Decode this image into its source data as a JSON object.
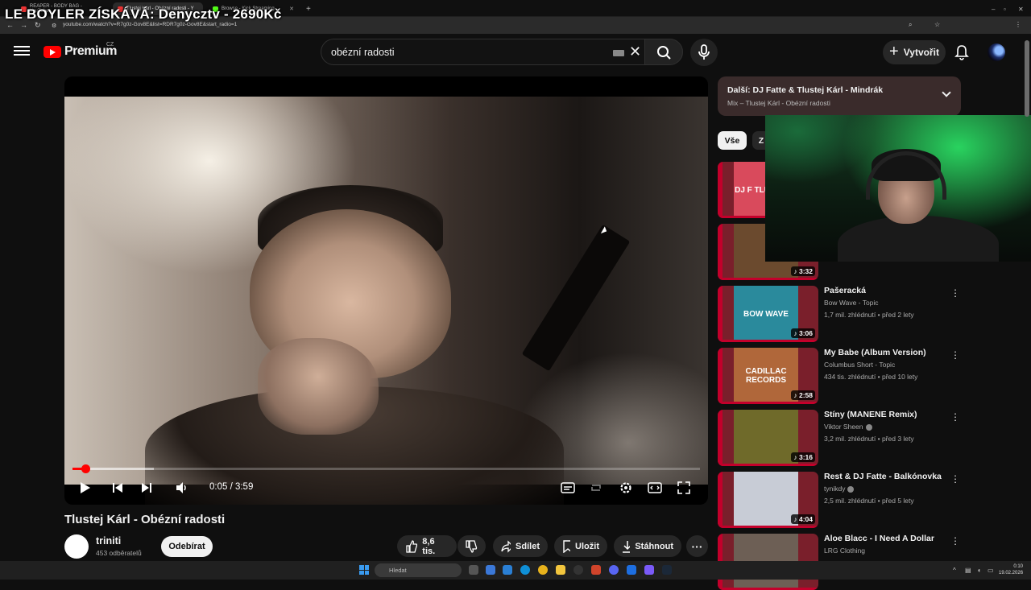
{
  "overlay_title": "LE BOYLER ZÍSKÁVÁ: Denycztv - 2690Kč",
  "browser": {
    "tabs": [
      {
        "label": "REAPER - BODY BAG - YouTube",
        "color": "#e33"
      },
      {
        "label": "Tlustej Kárl - Obézní radosti - Y",
        "color": "#e33"
      },
      {
        "label": "Browse - Kick Streaming",
        "color": "#53fc18"
      }
    ],
    "url": "youtube.com/watch?v=R7g0z-Gov8E&list=RDR7g0z-Gov8E&start_radio=1"
  },
  "header": {
    "logo": "Premium",
    "country": "CZ",
    "search_value": "obézní radosti",
    "create_label": "Vytvořit"
  },
  "player": {
    "time": "0:05 / 3:59",
    "progress": 0.021,
    "buffered": 0.13
  },
  "video": {
    "title": "Tlustej Kárl - Obézní radosti",
    "channel": "triniti",
    "subscribers": "453 odběratelů",
    "subscribe_label": "Odebírat",
    "likes": "8,6 tis.",
    "share_label": "Sdílet",
    "save_label": "Uložit",
    "download_label": "Stáhnout"
  },
  "playlist": {
    "next_title": "Další: DJ Fatte & Tlustej Kárl - Mindrák",
    "next_sub": "Mix – Tlustej Kárl - Obézní radosti"
  },
  "chips": [
    "Vše",
    "Z"
  ],
  "recommendations": [
    {
      "title": "",
      "channel": "",
      "meta": "",
      "duration": "",
      "thumb_text": "DJ F TLUST MIN",
      "thumb_color": "#d94a5c"
    },
    {
      "title": "",
      "channel": "",
      "meta": "",
      "duration": "3:32",
      "thumb_text": "",
      "thumb_color": "#6b4a2e"
    },
    {
      "title": "Pašeracká",
      "channel": "Bow Wave - Topic",
      "meta": "1,7 mil. zhlédnutí • před 2 lety",
      "duration": "3:06",
      "thumb_text": "BOW WAVE",
      "thumb_color": "#2a8a9c"
    },
    {
      "title": "My Babe (Album Version)",
      "channel": "Columbus Short - Topic",
      "meta": "434 tis. zhlédnutí • před 10 lety",
      "duration": "2:58",
      "thumb_text": "CADILLAC RECORDS",
      "thumb_color": "#b0673a"
    },
    {
      "title": "Stíny (MANENE Remix)",
      "channel": "Viktor Sheen",
      "meta": "3,2 mil. zhlédnutí • před 3 lety",
      "duration": "3:16",
      "thumb_text": "",
      "thumb_color": "#6f6a2a"
    },
    {
      "title": "Rest & DJ Fatte - Balkónovka",
      "channel": "tynikdy",
      "meta": "2,5 mil. zhlédnutí • před 5 lety",
      "duration": "4:04",
      "thumb_text": "",
      "thumb_color": "#c8ccd6"
    },
    {
      "title": "Aloe Blacc - I Need A Dollar",
      "channel": "LRG Clothing",
      "meta": "",
      "duration": "",
      "thumb_text": "",
      "thumb_color": "#6d5f55"
    }
  ],
  "taskbar": {
    "search_placeholder": "Hledat",
    "time": "0:10",
    "date": "19.02.2026"
  },
  "colors": {
    "accent": "#ff0000",
    "background": "#0f0f0f",
    "next_card": "#3a2b2b"
  }
}
